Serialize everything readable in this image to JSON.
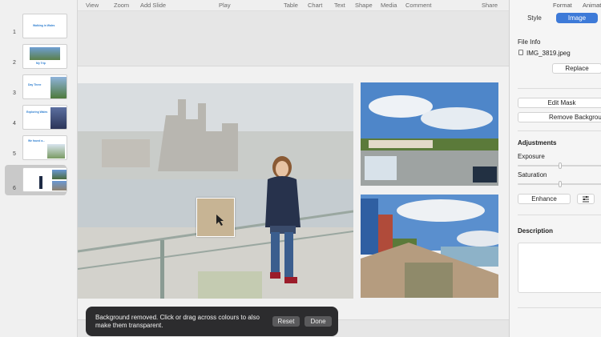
{
  "toolbar": {
    "view": "View",
    "zoom": "Zoom",
    "add_slide": "Add Slide",
    "play": "Play",
    "table": "Table",
    "chart": "Chart",
    "text": "Text",
    "shape": "Shape",
    "media": "Media",
    "comment": "Comment",
    "share": "Share",
    "format": "Format",
    "animate": "Animate"
  },
  "slides": [
    {
      "number": "1",
      "title": "Walking in Wales"
    },
    {
      "number": "2",
      "title": "My Trip"
    },
    {
      "number": "3",
      "title": "Day Three"
    },
    {
      "number": "4",
      "title": "Exploring Wales"
    },
    {
      "number": "5",
      "title": "We found a..."
    },
    {
      "number": "6",
      "title": ""
    }
  ],
  "inspector": {
    "tabs": {
      "style": "Style",
      "image": "Image"
    },
    "file_info_label": "File Info",
    "file_name": "IMG_3819.jpeg",
    "replace": "Replace",
    "edit_mask": "Edit Mask",
    "remove_background": "Remove Background",
    "adjustments_label": "Adjustments",
    "exposure_label": "Exposure",
    "exposure_value": 0.5,
    "saturation_label": "Saturation",
    "saturation_value": 0.5,
    "enhance": "Enhance",
    "description_label": "Description"
  },
  "toast": {
    "message": "Background removed. Click or drag across colours to also make them transparent.",
    "reset": "Reset",
    "done": "Done"
  },
  "colors": {
    "accent": "#3d7ad8",
    "toast_bg": "#2c2c2e"
  }
}
